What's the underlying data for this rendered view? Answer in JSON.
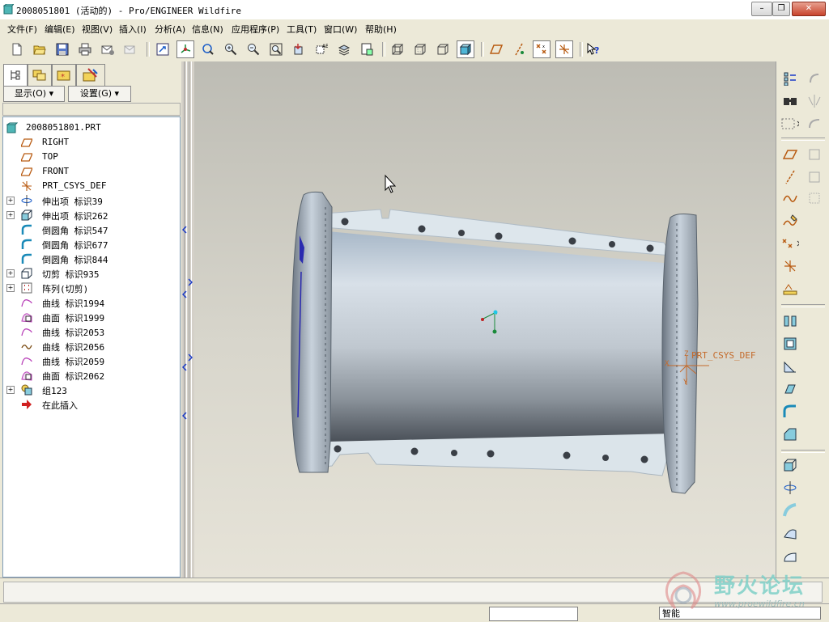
{
  "window": {
    "title": "2008051801 (活动的) - Pro/ENGINEER Wildfire",
    "icon": "model-cube-icon",
    "controls": [
      "minimize",
      "restore",
      "close"
    ]
  },
  "menu": [
    "文件(F)",
    "编辑(E)",
    "视图(V)",
    "插入(I)",
    "分析(A)",
    "信息(N)",
    "应用程序(P)",
    "工具(T)",
    "窗口(W)",
    "帮助(H)"
  ],
  "toolbar": {
    "icons": [
      "new-file-icon",
      "open-folder-icon",
      "save-icon",
      "print-icon",
      "email-icon",
      "email-disabled-icon",
      "redraw-icon",
      "spin-center-icon",
      "orient-mode-icon",
      "zoom-in-icon",
      "zoom-out-icon",
      "refit-icon",
      "reorient-icon",
      "saved-views-icon",
      "layers-icon",
      "view-manager-icon",
      "wireframe-icon",
      "hidden-line-icon",
      "no-hidden-icon",
      "shading-icon",
      "datum-planes-icon",
      "datum-axes-icon",
      "datum-points-icon",
      "csys-icon",
      "context-help-icon"
    ]
  },
  "navigator": {
    "tabs": [
      "model-tree-tab-icon",
      "folder-browser-tab-icon",
      "favorites-tab-icon",
      "connections-tab-icon"
    ],
    "show_label": "显示(O)",
    "settings_label": "设置(G)",
    "tree": [
      {
        "label": "2008051801.PRT",
        "icon": "part-icon",
        "expand": false,
        "level": 0
      },
      {
        "label": "RIGHT",
        "icon": "datum-plane-icon",
        "expand": false,
        "level": 1
      },
      {
        "label": "TOP",
        "icon": "datum-plane-icon",
        "expand": false,
        "level": 1
      },
      {
        "label": "FRONT",
        "icon": "datum-plane-icon",
        "expand": false,
        "level": 1
      },
      {
        "label": "PRT_CSYS_DEF",
        "icon": "csys-icon",
        "expand": false,
        "level": 1
      },
      {
        "label": "伸出项 标识39",
        "icon": "revolve-icon",
        "expand": true,
        "level": 1
      },
      {
        "label": "伸出项 标识262",
        "icon": "extrude-icon",
        "expand": true,
        "level": 1
      },
      {
        "label": "倒圆角 标识547",
        "icon": "round-icon",
        "expand": false,
        "level": 1
      },
      {
        "label": "倒圆角 标识677",
        "icon": "round-icon",
        "expand": false,
        "level": 1
      },
      {
        "label": "倒圆角 标识844",
        "icon": "round-icon",
        "expand": false,
        "level": 1
      },
      {
        "label": "切剪 标识935",
        "icon": "cut-icon",
        "expand": true,
        "level": 1
      },
      {
        "label": "阵列(切剪)",
        "icon": "pattern-icon",
        "expand": true,
        "level": 1
      },
      {
        "label": "曲线 标识1994",
        "icon": "curve-icon",
        "expand": false,
        "level": 1
      },
      {
        "label": "曲面 标识1999",
        "icon": "surface-icon",
        "expand": false,
        "level": 1
      },
      {
        "label": "曲线 标识2053",
        "icon": "curve-icon",
        "expand": false,
        "level": 1
      },
      {
        "label": "曲线 标识2056",
        "icon": "sketch-curve-icon",
        "expand": false,
        "level": 1
      },
      {
        "label": "曲线 标识2059",
        "icon": "curve-icon",
        "expand": false,
        "level": 1
      },
      {
        "label": "曲面 标识2062",
        "icon": "surface-icon",
        "expand": false,
        "level": 1
      },
      {
        "label": "组123",
        "icon": "group-icon",
        "expand": true,
        "level": 1
      },
      {
        "label": "在此插入",
        "icon": "insert-here-arrow-icon",
        "expand": false,
        "level": 1
      }
    ]
  },
  "viewport": {
    "csys_label": "PRT_CSYS_DEF",
    "axis_labels": {
      "z": "Z",
      "x": "X",
      "y": "Y"
    },
    "model": "cylindrical-part-with-flanges"
  },
  "right_toolbar": {
    "icons": [
      "regenerate-icon",
      "find-icon",
      "select-box-icon",
      "datum-plane-tool-icon",
      "datum-axis-tool-icon",
      "datum-curve-tool-icon",
      "sketch-tool-icon",
      "datum-point-tool-icon",
      "csys-tool-icon",
      "analysis-feature-icon",
      "hole-tool-icon",
      "shell-tool-icon",
      "rib-tool-icon",
      "draft-tool-icon",
      "round-tool-icon",
      "chamfer-tool-icon",
      "extrude-tool-icon",
      "revolve-tool-icon",
      "sweep-tool-icon",
      "boundary-blend-icon",
      "style-tool-icon",
      "mirror-tool-icon",
      "merge-tool-icon",
      "trim-tool-icon",
      "pattern-tool-icon",
      "offset-tool-icon",
      "thicken-tool-icon"
    ]
  },
  "status": {
    "filter_value": "智能"
  },
  "watermark": {
    "text": "野火论坛",
    "url": "www.proewildfire.cn"
  },
  "colors": {
    "model_body": "#c3ccd4",
    "flange": "#d8e2e8",
    "csys": "#c46a2a",
    "tree_border": "#7f9db9"
  }
}
